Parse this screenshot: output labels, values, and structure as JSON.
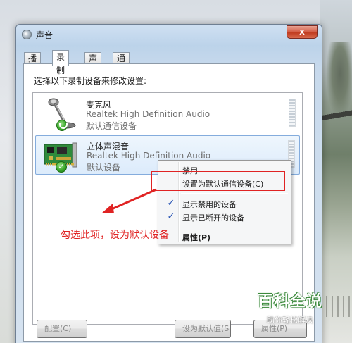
{
  "window": {
    "title": "声音",
    "close_label": "x"
  },
  "tabs": [
    {
      "label": "播放"
    },
    {
      "label": "录制"
    },
    {
      "label": "声音"
    },
    {
      "label": "通信"
    }
  ],
  "instruction": "选择以下录制设备来修改设置:",
  "devices": [
    {
      "name": "麦克风",
      "driver": "Realtek High Definition Audio",
      "status": "默认通信设备",
      "icon": "microphone-icon",
      "badge": "phone-badge-icon"
    },
    {
      "name": "立体声混音",
      "driver": "Realtek High Definition Audio",
      "status": "默认设备",
      "icon": "sound-card-icon",
      "badge": "green-check-icon"
    }
  ],
  "context_menu": {
    "items": [
      {
        "label": "禁用",
        "checked": false
      },
      {
        "label": "设置为默认通信设备(C)",
        "checked": false
      },
      {
        "label": "显示禁用的设备",
        "checked": true
      },
      {
        "label": "显示已断开的设备",
        "checked": true
      },
      {
        "label": "属性(P)",
        "checked": false
      }
    ],
    "check_glyph": "✓"
  },
  "annotation": {
    "text": "勾选此项，设为默认设备",
    "color": "#e02323"
  },
  "buttons": {
    "configure": "配置(C)",
    "set_default": "设为默认值(S)",
    "properties": "属性(P)"
  },
  "watermark": {
    "title": "百科全说",
    "subtitle": "助你轻松解决"
  }
}
